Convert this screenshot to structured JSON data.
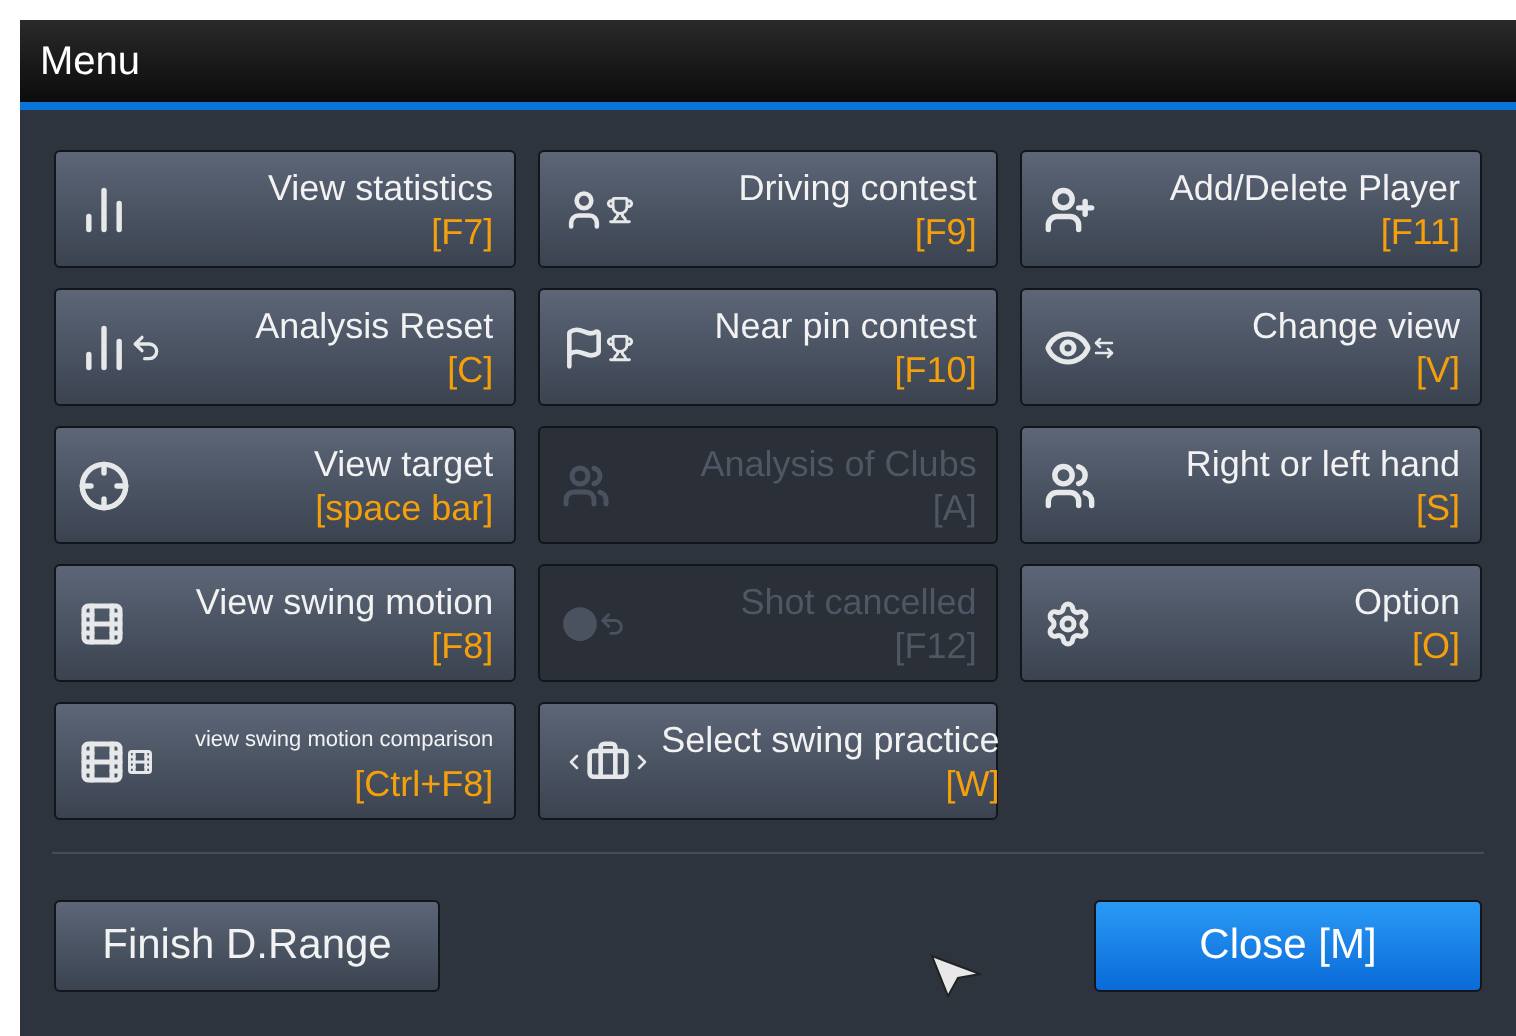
{
  "window": {
    "title": "Menu"
  },
  "menu_items": [
    {
      "kind": "statistics",
      "label": "View statistics",
      "shortcut": "[F7]",
      "disabled": false
    },
    {
      "kind": "driving",
      "label": "Driving contest",
      "shortcut": "[F9]",
      "disabled": false
    },
    {
      "kind": "player",
      "label": "Add/Delete Player",
      "shortcut": "[F11]",
      "disabled": false
    },
    {
      "kind": "reset",
      "label": "Analysis Reset",
      "shortcut": "[C]",
      "disabled": false
    },
    {
      "kind": "pin",
      "label": "Near pin contest",
      "shortcut": "[F10]",
      "disabled": false
    },
    {
      "kind": "view",
      "label": "Change view",
      "shortcut": "[V]",
      "disabled": false
    },
    {
      "kind": "target",
      "label": "View target",
      "shortcut": "[space bar]",
      "disabled": false
    },
    {
      "kind": "clubs",
      "label": "Analysis of Clubs",
      "shortcut": "[A]",
      "disabled": true
    },
    {
      "kind": "hand",
      "label": "Right or left hand",
      "shortcut": "[S]",
      "disabled": false
    },
    {
      "kind": "motion",
      "label": "View swing motion",
      "shortcut": "[F8]",
      "disabled": false
    },
    {
      "kind": "cancel",
      "label": "Shot cancelled",
      "shortcut": "[F12]",
      "disabled": true
    },
    {
      "kind": "option",
      "label": "Option",
      "shortcut": "[O]",
      "disabled": false
    },
    {
      "kind": "comparison",
      "label": "view swing motion comparison",
      "shortcut": "[Ctrl+F8]",
      "disabled": false
    },
    {
      "kind": "practice",
      "label": "Select swing practice",
      "shortcut": "[W]",
      "disabled": false
    }
  ],
  "footer": {
    "finish_button": "Finish D.Range",
    "close_button": "Close [M]"
  }
}
